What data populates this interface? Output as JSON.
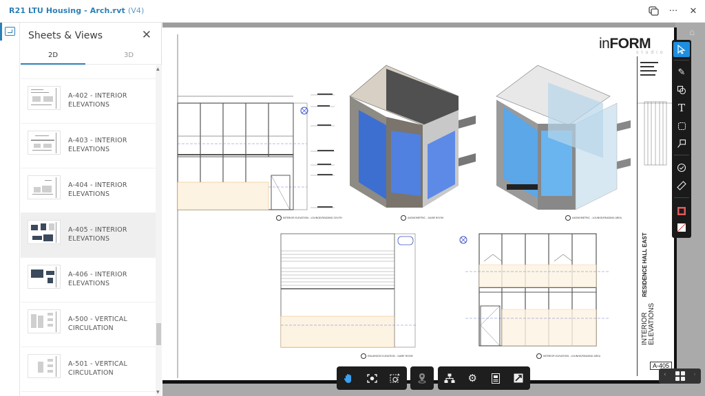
{
  "header": {
    "doc_title": "R21 LTU Housing - Arch.rvt",
    "doc_version": "(V4)",
    "icons": [
      "compare-icon",
      "more-icon",
      "close-icon"
    ],
    "more_glyph": "···",
    "close_glyph": "✕"
  },
  "left_rail": {
    "items": [
      {
        "icon": "sheets-views-icon",
        "active": true
      }
    ]
  },
  "panel": {
    "title": "Sheets & Views",
    "close_glyph": "✕",
    "tabs": [
      {
        "label": "2D",
        "active": true
      },
      {
        "label": "3D",
        "active": false
      }
    ],
    "items": [
      {
        "line1": "A-402 - INTERIOR",
        "line2": "ELEVATIONS",
        "selected": false
      },
      {
        "line1": "A-403 - INTERIOR",
        "line2": "ELEVATIONS",
        "selected": false
      },
      {
        "line1": "A-404 - INTERIOR",
        "line2": "ELEVATIONS",
        "selected": false
      },
      {
        "line1": "A-405 - INTERIOR",
        "line2": "ELEVATIONS",
        "selected": true
      },
      {
        "line1": "A-406 - INTERIOR",
        "line2": "ELEVATIONS",
        "selected": false
      },
      {
        "line1": "A-500 - VERTICAL",
        "line2": "CIRCULATION",
        "selected": false
      },
      {
        "line1": "A-501 - VERTICAL",
        "line2": "CIRCULATION",
        "selected": false
      }
    ]
  },
  "sheet": {
    "brand_bold": "FORM",
    "brand_prefix": "in",
    "brand_sub": "studio",
    "title_vertical": "INTERIOR ELEVATIONS",
    "project_vertical": "RESIDENCE HALL EAST",
    "sheet_number": "A-405",
    "views": [
      {
        "name": "interior-elevation-lounge-south",
        "caption": "INTERIOR ELEVATION - LOUNGE/READING SOUTH"
      },
      {
        "name": "axonometric-game-room",
        "caption": "AXONOMETRIC - GAME ROOM"
      },
      {
        "name": "axonometric-lounge-reading",
        "caption": "AXONOMETRIC - LOUNGE/READING AREA"
      },
      {
        "name": "enlarged-elevation-game-room",
        "caption": "ENLARGED ELEVATION - GAME ROOM"
      },
      {
        "name": "interior-elevation-lounge-reading",
        "caption": "INTERIOR ELEVATION - LOUNGE/READING AREA"
      }
    ]
  },
  "markup_toolbar": {
    "tools": [
      {
        "name": "select-tool",
        "glyph": "↖",
        "active": true
      },
      {
        "name": "freehand-tool",
        "glyph": "✎",
        "active": false
      },
      {
        "name": "shapes-tool",
        "glyph": "◎",
        "active": false
      },
      {
        "name": "text-tool",
        "glyph": "T",
        "active": false
      },
      {
        "name": "cloud-tool",
        "glyph": "⬚",
        "active": false
      },
      {
        "name": "callout-tool",
        "glyph": "⤡",
        "active": false
      },
      {
        "name": "stamp-tool",
        "glyph": "✓",
        "active": false
      },
      {
        "name": "measure-tool",
        "glyph": "📏",
        "active": false
      },
      {
        "name": "stroke-color",
        "glyph": "",
        "active": false,
        "color": "#e05a5a"
      },
      {
        "name": "fill-color",
        "glyph": "",
        "active": false
      }
    ]
  },
  "bottom_toolbar": {
    "group1": [
      {
        "name": "pan-tool",
        "glyph": "✋",
        "active": true
      },
      {
        "name": "fit-to-view",
        "glyph": "⛶"
      },
      {
        "name": "zoom-window",
        "glyph": "⊕"
      }
    ],
    "group2": [
      {
        "name": "location",
        "glyph": "📍",
        "disabled": true
      }
    ],
    "group3": [
      {
        "name": "model-browser",
        "glyph": "⊤"
      },
      {
        "name": "settings",
        "glyph": "⚙"
      },
      {
        "name": "properties",
        "glyph": "▤"
      },
      {
        "name": "fullscreen",
        "glyph": "⤢"
      }
    ]
  },
  "pager": {
    "prev": "‹",
    "next": "›"
  },
  "colors": {
    "accent": "#2d7fb4",
    "tool_active": "#1e8ee0",
    "toolbar_bg": "#1e1e1e",
    "viewer_bg": "#aaaaaa",
    "selected_item_bg": "#efefef"
  }
}
